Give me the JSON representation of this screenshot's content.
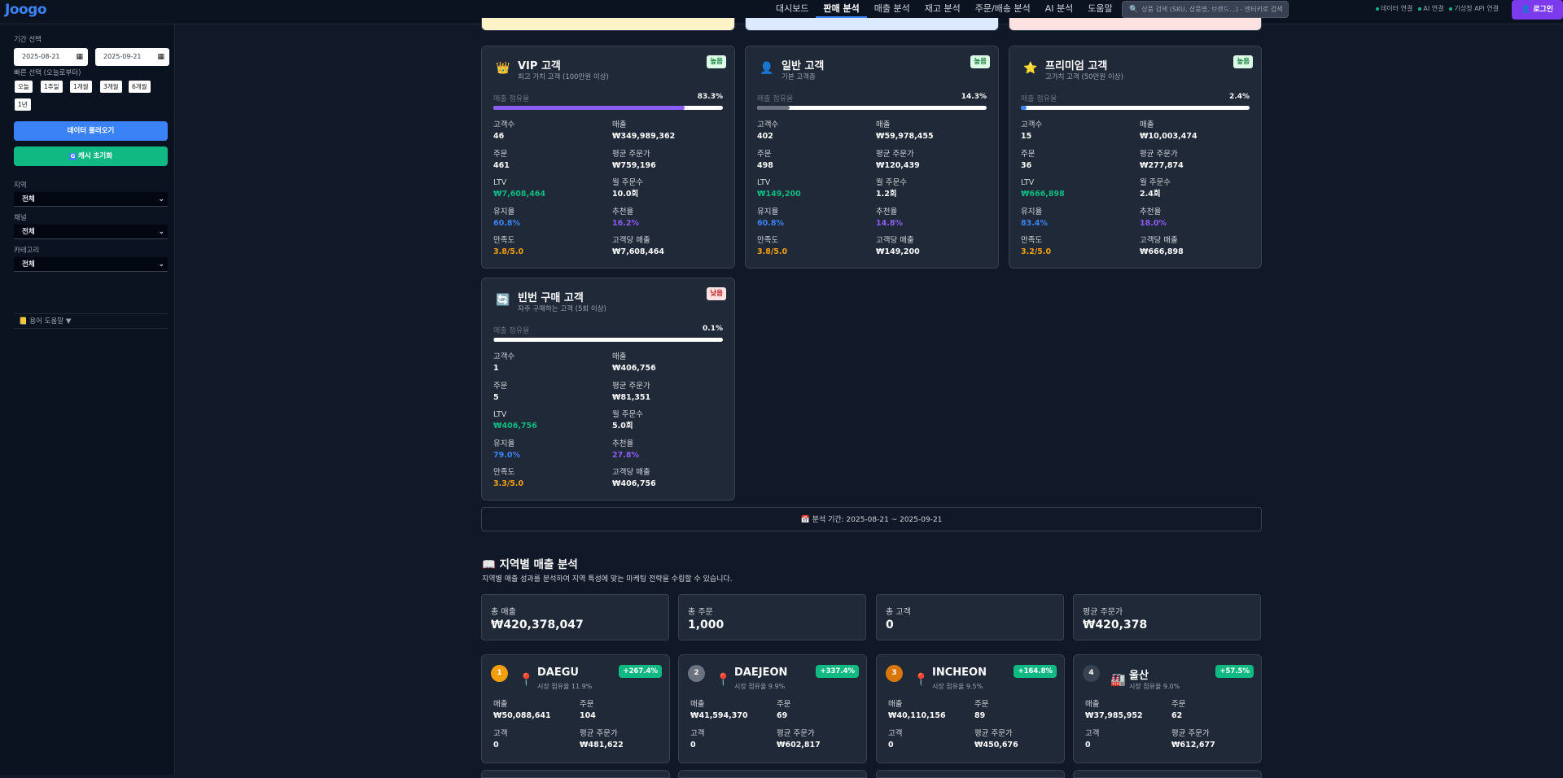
{
  "app": {
    "logo": "Joogo"
  },
  "nav": {
    "items": [
      "대시보드",
      "판매 분석",
      "매출 분석",
      "재고 분석",
      "주문/배송 분석",
      "AI 분석",
      "도움말"
    ]
  },
  "search": {
    "placeholder": "상품 검색 (SKU, 상품명, 브랜드...) - 엔터키로 검색",
    "icon": "search-icon"
  },
  "status": {
    "items": [
      "데이터 연결",
      "AI 연결",
      "기상청 API 연결"
    ]
  },
  "login": {
    "label": "로그인"
  },
  "sidebar": {
    "period_label": "기간 선택",
    "date_start": "2025-08-21",
    "date_end": "2025-09-21",
    "quick_label": "빠른 선택 (오늘로부터)",
    "quick": [
      "오늘",
      "1주일",
      "1개월",
      "3개월",
      "6개월",
      "1년"
    ],
    "load_button": "데이터 불러오기",
    "cache_button": "캐시 초기화",
    "region_label": "지역",
    "region_value": "전체",
    "channel_label": "채널",
    "channel_value": "전체",
    "category_label": "카테고리",
    "category_value": "전체",
    "glossary": "용어 도움말"
  },
  "segments": [
    {
      "icon": "crown-icon",
      "title": "VIP 고객",
      "subtitle": "최고 가치 고객 (100만원 이상)",
      "badge": "높음",
      "share_label": "매출 점유율",
      "share": "83.3%",
      "share_value": 83.3,
      "bar_color": "#8b5cf6",
      "metrics": [
        {
          "k": "고객수",
          "v": "46",
          "c": ""
        },
        {
          "k": "매출",
          "v": "₩349,989,362",
          "c": ""
        },
        {
          "k": "주문",
          "v": "461",
          "c": ""
        },
        {
          "k": "평균 주문가",
          "v": "₩759,196",
          "c": ""
        },
        {
          "k": "LTV",
          "v": "₩7,608,464",
          "c": "green"
        },
        {
          "k": "월 주문수",
          "v": "10.0회",
          "c": ""
        },
        {
          "k": "유지율",
          "v": "60.8%",
          "c": "blue"
        },
        {
          "k": "추천율",
          "v": "16.2%",
          "c": "purple"
        },
        {
          "k": "만족도",
          "v": "3.8/5.0",
          "c": "orange"
        },
        {
          "k": "고객당 매출",
          "v": "₩7,608,464",
          "c": ""
        }
      ]
    },
    {
      "icon": "person-icon",
      "title": "일반 고객",
      "subtitle": "기본 고객층",
      "badge": "높음",
      "share_label": "매출 점유율",
      "share": "14.3%",
      "share_value": 14.3,
      "bar_color": "#6b7280",
      "metrics": [
        {
          "k": "고객수",
          "v": "402",
          "c": ""
        },
        {
          "k": "매출",
          "v": "₩59,978,455",
          "c": ""
        },
        {
          "k": "주문",
          "v": "498",
          "c": ""
        },
        {
          "k": "평균 주문가",
          "v": "₩120,439",
          "c": ""
        },
        {
          "k": "LTV",
          "v": "₩149,200",
          "c": "green"
        },
        {
          "k": "월 주문수",
          "v": "1.2회",
          "c": ""
        },
        {
          "k": "유지율",
          "v": "60.8%",
          "c": "blue"
        },
        {
          "k": "추천율",
          "v": "14.8%",
          "c": "purple"
        },
        {
          "k": "만족도",
          "v": "3.8/5.0",
          "c": "orange"
        },
        {
          "k": "고객당 매출",
          "v": "₩149,200",
          "c": ""
        }
      ]
    },
    {
      "icon": "star-icon",
      "title": "프리미엄 고객",
      "subtitle": "고가치 고객 (50만원 이상)",
      "badge": "높음",
      "share_label": "매출 점유율",
      "share": "2.4%",
      "share_value": 2.4,
      "bar_color": "#3b82f6",
      "metrics": [
        {
          "k": "고객수",
          "v": "15",
          "c": ""
        },
        {
          "k": "매출",
          "v": "₩10,003,474",
          "c": ""
        },
        {
          "k": "주문",
          "v": "36",
          "c": ""
        },
        {
          "k": "평균 주문가",
          "v": "₩277,874",
          "c": ""
        },
        {
          "k": "LTV",
          "v": "₩666,898",
          "c": "green"
        },
        {
          "k": "월 주문수",
          "v": "2.4회",
          "c": ""
        },
        {
          "k": "유지율",
          "v": "83.4%",
          "c": "blue"
        },
        {
          "k": "추천율",
          "v": "18.0%",
          "c": "purple"
        },
        {
          "k": "만족도",
          "v": "3.2/5.0",
          "c": "orange"
        },
        {
          "k": "고객당 매출",
          "v": "₩666,898",
          "c": ""
        }
      ]
    },
    {
      "icon": "repeat-icon",
      "title": "빈번 구매 고객",
      "subtitle": "자주 구매하는 고객 (5회 이상)",
      "badge": "낮음",
      "share_label": "매출 점유율",
      "share": "0.1%",
      "share_value": 0.1,
      "bar_color": "#10b981",
      "metrics": [
        {
          "k": "고객수",
          "v": "1",
          "c": ""
        },
        {
          "k": "매출",
          "v": "₩406,756",
          "c": ""
        },
        {
          "k": "주문",
          "v": "5",
          "c": ""
        },
        {
          "k": "평균 주문가",
          "v": "₩81,351",
          "c": ""
        },
        {
          "k": "LTV",
          "v": "₩406,756",
          "c": "green"
        },
        {
          "k": "월 주문수",
          "v": "5.0회",
          "c": ""
        },
        {
          "k": "유지율",
          "v": "79.0%",
          "c": "blue"
        },
        {
          "k": "추천율",
          "v": "27.8%",
          "c": "purple"
        },
        {
          "k": "만족도",
          "v": "3.3/5.0",
          "c": "orange"
        },
        {
          "k": "고객당 매출",
          "v": "₩406,756",
          "c": ""
        }
      ]
    }
  ],
  "period": {
    "text": "📅 분석 기간: 2025-08-21 ~ 2025-09-21"
  },
  "region_section": {
    "title": "📖 지역별 매출 분석",
    "description": "지역별 매출 성과를 분석하여 지역 특성에 맞는 마케팅 전략을 수립할 수 있습니다.",
    "stats": [
      {
        "k": "총 매출",
        "v": "₩420,378,047"
      },
      {
        "k": "총 주문",
        "v": "1,000"
      },
      {
        "k": "총 고객",
        "v": "0"
      },
      {
        "k": "평균 주문가",
        "v": "₩420,378"
      }
    ],
    "regions": [
      {
        "rank": "1",
        "rank_color": "#f59e0b",
        "icon": "pin-icon",
        "name": "DAEGU",
        "share": "시장 점유율 11.9%",
        "growth": "+267.4%",
        "metrics": [
          {
            "k": "매출",
            "v": "₩50,088,641"
          },
          {
            "k": "주문",
            "v": "104"
          },
          {
            "k": "고객",
            "v": "0"
          },
          {
            "k": "평균 주문가",
            "v": "₩481,622"
          }
        ]
      },
      {
        "rank": "2",
        "rank_color": "#6b7280",
        "icon": "pin-icon",
        "name": "DAEJEON",
        "share": "시장 점유율 9.9%",
        "growth": "+337.4%",
        "metrics": [
          {
            "k": "매출",
            "v": "₩41,594,370"
          },
          {
            "k": "주문",
            "v": "69"
          },
          {
            "k": "고객",
            "v": "0"
          },
          {
            "k": "평균 주문가",
            "v": "₩602,817"
          }
        ]
      },
      {
        "rank": "3",
        "rank_color": "#d97706",
        "icon": "pin-icon",
        "name": "INCHEON",
        "share": "시장 점유율 9.5%",
        "growth": "+164.8%",
        "metrics": [
          {
            "k": "매출",
            "v": "₩40,110,156"
          },
          {
            "k": "주문",
            "v": "89"
          },
          {
            "k": "고객",
            "v": "0"
          },
          {
            "k": "평균 주문가",
            "v": "₩450,676"
          }
        ]
      },
      {
        "rank": "4",
        "rank_color": "#374151",
        "icon": "factory-icon",
        "name": "울산",
        "share": "시장 점유율 9.0%",
        "growth": "+57.5%",
        "metrics": [
          {
            "k": "매출",
            "v": "₩37,985,952"
          },
          {
            "k": "주문",
            "v": "62"
          },
          {
            "k": "고객",
            "v": "0"
          },
          {
            "k": "평균 주문가",
            "v": "₩612,677"
          }
        ]
      }
    ]
  }
}
